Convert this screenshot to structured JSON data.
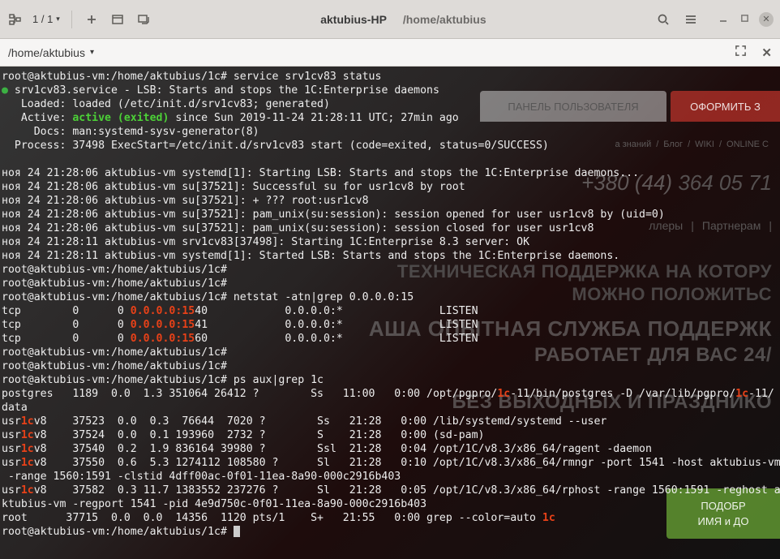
{
  "titlebar": {
    "counter": "1 / 1",
    "app_title": "aktubius-HP",
    "path_title": "/home/aktubius"
  },
  "pathbar": {
    "path": "/home/aktubius"
  },
  "background": {
    "tab_user_panel": "ПАНЕЛЬ ПОЛЬЗОВАТЕЛЯ",
    "tab_order": "ОФОРМИТЬ З",
    "crumbs": [
      "а знаний",
      "Блог",
      "WIKI",
      "ONLINE C"
    ],
    "phone_prefix": "+380 (44)",
    "phone_number": "364 05 71",
    "nav": [
      "ллеры",
      "Партнерам"
    ],
    "line1": "ТЕХНИЧЕСКАЯ ПОДДЕРЖКА НА КОТОРУ",
    "line2": "МОЖНО ПОЛОЖИТЬС",
    "line3": "АША ОПЫТНАЯ СЛУЖБА ПОДДЕРЖК",
    "line4": "РАБОТАЕТ ДЛЯ ВАС 24/",
    "line5": "БЕЗ ВЫХОДНЫХ И ПРАЗДНИКО",
    "btn_l1": "ПОДОБР",
    "btn_l2": "ИМЯ и ДО"
  },
  "term": {
    "l01": "root@aktubius-vm:/home/aktubius/1c# service srv1cv83 status",
    "l02a": "●",
    "l02b": " srv1cv83.service - LSB: Starts and stops the 1C:Enterprise daemons",
    "l03": "   Loaded: loaded (/etc/init.d/srv1cv83; generated)",
    "l04a": "   Active: ",
    "l04b": "active (exited)",
    "l04c": " since Sun 2019-11-24 21:28:11 UTC; 27min ago",
    "l05": "     Docs: man:systemd-sysv-generator(8)",
    "l06": "  Process: 37498 ExecStart=/etc/init.d/srv1cv83 start (code=exited, status=0/SUCCESS)",
    "l07": "ноя 24 21:28:06 aktubius-vm systemd[1]: Starting LSB: Starts and stops the 1C:Enterprise daemons...",
    "l08": "ноя 24 21:28:06 aktubius-vm su[37521]: Successful su for usr1cv8 by root",
    "l09": "ноя 24 21:28:06 aktubius-vm su[37521]: + ??? root:usr1cv8",
    "l10": "ноя 24 21:28:06 aktubius-vm su[37521]: pam_unix(su:session): session opened for user usr1cv8 by (uid=0)",
    "l11": "ноя 24 21:28:06 aktubius-vm su[37521]: pam_unix(su:session): session closed for user usr1cv8",
    "l12": "ноя 24 21:28:11 aktubius-vm srv1cv83[37498]: Starting 1C:Enterprise 8.3 server: OK",
    "l13": "ноя 24 21:28:11 aktubius-vm systemd[1]: Started LSB: Starts and stops the 1C:Enterprise daemons.",
    "l14": "root@aktubius-vm:/home/aktubius/1c#",
    "l15": "root@aktubius-vm:/home/aktubius/1c#",
    "l16": "root@aktubius-vm:/home/aktubius/1c# netstat -atn|grep 0.0.0.0:15",
    "l17a": "tcp        0      0 ",
    "l17b": "0.0.0.0:15",
    "l17c": "40            0.0.0.0:*               LISTEN",
    "l18a": "tcp        0      0 ",
    "l18b": "0.0.0.0:15",
    "l18c": "41            0.0.0.0:*               LISTEN",
    "l19a": "tcp        0      0 ",
    "l19b": "0.0.0.0:15",
    "l19c": "60            0.0.0.0:*               LISTEN",
    "l20": "root@aktubius-vm:/home/aktubius/1c#",
    "l21": "root@aktubius-vm:/home/aktubius/1c#",
    "l22": "root@aktubius-vm:/home/aktubius/1c# ps aux|grep 1c",
    "l23a": "postgres   1189  0.0  1.3 351064 26412 ?        Ss   11:00   0:00 /opt/pgpro/",
    "l23b": "1c",
    "l23c": "-11/bin/postgres -D /var/lib/pgpro/",
    "l23d": "1c",
    "l23e": "-11/",
    "l24": "data",
    "l25a": "usr",
    "l25b": "1c",
    "l25c": "v8    37523  0.0  0.3  76644  7020 ?        Ss   21:28   0:00 /lib/systemd/systemd --user",
    "l26a": "usr",
    "l26b": "1c",
    "l26c": "v8    37524  0.0  0.1 193960  2732 ?        S    21:28   0:00 (sd-pam)",
    "l27a": "usr",
    "l27b": "1c",
    "l27c": "v8    37540  0.2  1.9 836164 39980 ?        Ssl  21:28   0:04 /opt/1C/v8.3/x86_64/ragent -daemon",
    "l28a": "usr",
    "l28b": "1c",
    "l28c": "v8    37550  0.6  5.3 1274112 108580 ?      Sl   21:28   0:10 /opt/1C/v8.3/x86_64/rmngr -port 1541 -host aktubius-vm",
    "l29": " -range 1560:1591 -clstid 4dff00ac-0f01-11ea-8a90-000c2916b403",
    "l30a": "usr",
    "l30b": "1c",
    "l30c": "v8    37582  0.3 11.7 1383552 237276 ?      Sl   21:28   0:05 /opt/1C/v8.3/x86_64/rphost -range 1560:1591 -reghost a",
    "l31": "ktubius-vm -regport 1541 -pid 4e9d750c-0f01-11ea-8a90-000c2916b403",
    "l32a": "root      37715  0.0  0.0  14356  1120 pts/1    S+   21:55   0:00 grep --color=auto ",
    "l32b": "1c",
    "l33": "root@aktubius-vm:/home/aktubius/1c# "
  }
}
